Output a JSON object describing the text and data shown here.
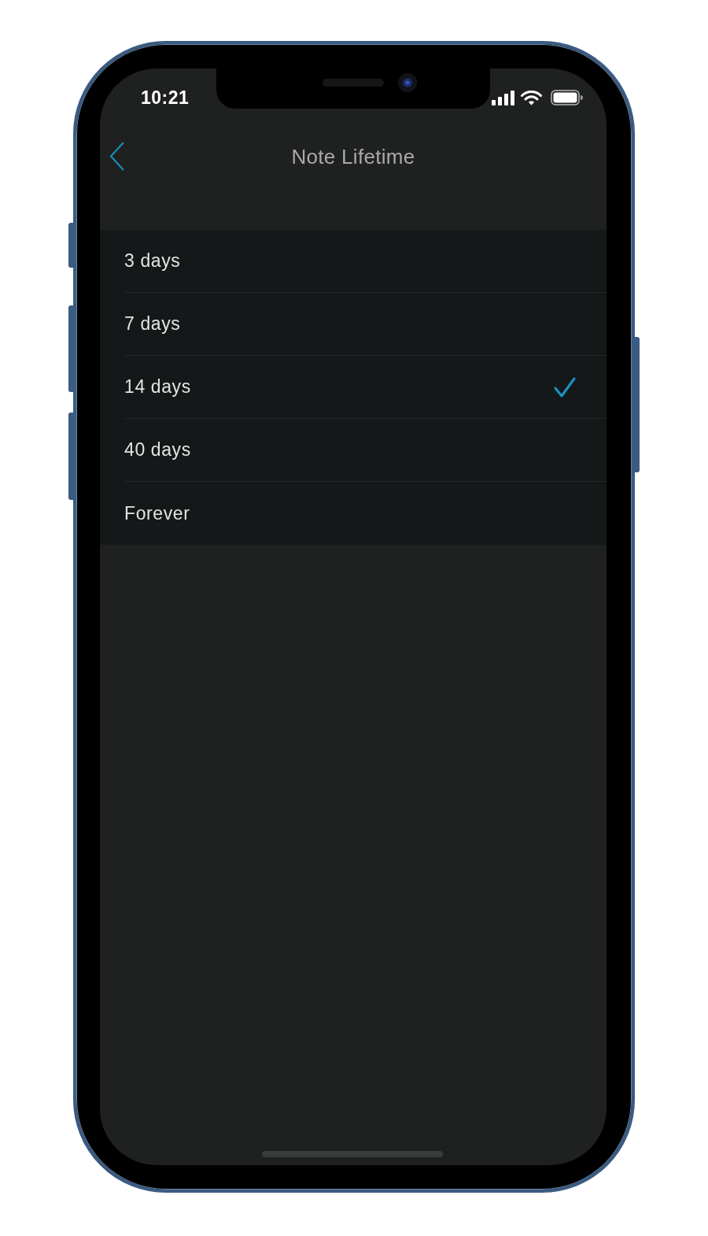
{
  "status_bar": {
    "time": "10:21"
  },
  "nav_bar": {
    "title": "Note Lifetime"
  },
  "options": [
    {
      "label": "3 days",
      "selected": false
    },
    {
      "label": "7 days",
      "selected": false
    },
    {
      "label": "14 days",
      "selected": true
    },
    {
      "label": "40 days",
      "selected": false
    },
    {
      "label": "Forever",
      "selected": false
    }
  ]
}
